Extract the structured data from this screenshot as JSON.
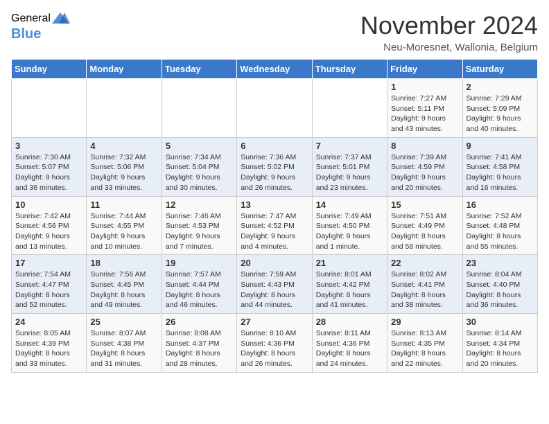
{
  "logo": {
    "general": "General",
    "blue": "Blue"
  },
  "title": "November 2024",
  "location": "Neu-Moresnet, Wallonia, Belgium",
  "headers": [
    "Sunday",
    "Monday",
    "Tuesday",
    "Wednesday",
    "Thursday",
    "Friday",
    "Saturday"
  ],
  "weeks": [
    [
      {
        "day": "",
        "info": ""
      },
      {
        "day": "",
        "info": ""
      },
      {
        "day": "",
        "info": ""
      },
      {
        "day": "",
        "info": ""
      },
      {
        "day": "",
        "info": ""
      },
      {
        "day": "1",
        "info": "Sunrise: 7:27 AM\nSunset: 5:11 PM\nDaylight: 9 hours and 43 minutes."
      },
      {
        "day": "2",
        "info": "Sunrise: 7:29 AM\nSunset: 5:09 PM\nDaylight: 9 hours and 40 minutes."
      }
    ],
    [
      {
        "day": "3",
        "info": "Sunrise: 7:30 AM\nSunset: 5:07 PM\nDaylight: 9 hours and 36 minutes."
      },
      {
        "day": "4",
        "info": "Sunrise: 7:32 AM\nSunset: 5:06 PM\nDaylight: 9 hours and 33 minutes."
      },
      {
        "day": "5",
        "info": "Sunrise: 7:34 AM\nSunset: 5:04 PM\nDaylight: 9 hours and 30 minutes."
      },
      {
        "day": "6",
        "info": "Sunrise: 7:36 AM\nSunset: 5:02 PM\nDaylight: 9 hours and 26 minutes."
      },
      {
        "day": "7",
        "info": "Sunrise: 7:37 AM\nSunset: 5:01 PM\nDaylight: 9 hours and 23 minutes."
      },
      {
        "day": "8",
        "info": "Sunrise: 7:39 AM\nSunset: 4:59 PM\nDaylight: 9 hours and 20 minutes."
      },
      {
        "day": "9",
        "info": "Sunrise: 7:41 AM\nSunset: 4:58 PM\nDaylight: 9 hours and 16 minutes."
      }
    ],
    [
      {
        "day": "10",
        "info": "Sunrise: 7:42 AM\nSunset: 4:56 PM\nDaylight: 9 hours and 13 minutes."
      },
      {
        "day": "11",
        "info": "Sunrise: 7:44 AM\nSunset: 4:55 PM\nDaylight: 9 hours and 10 minutes."
      },
      {
        "day": "12",
        "info": "Sunrise: 7:46 AM\nSunset: 4:53 PM\nDaylight: 9 hours and 7 minutes."
      },
      {
        "day": "13",
        "info": "Sunrise: 7:47 AM\nSunset: 4:52 PM\nDaylight: 9 hours and 4 minutes."
      },
      {
        "day": "14",
        "info": "Sunrise: 7:49 AM\nSunset: 4:50 PM\nDaylight: 9 hours and 1 minute."
      },
      {
        "day": "15",
        "info": "Sunrise: 7:51 AM\nSunset: 4:49 PM\nDaylight: 8 hours and 58 minutes."
      },
      {
        "day": "16",
        "info": "Sunrise: 7:52 AM\nSunset: 4:48 PM\nDaylight: 8 hours and 55 minutes."
      }
    ],
    [
      {
        "day": "17",
        "info": "Sunrise: 7:54 AM\nSunset: 4:47 PM\nDaylight: 8 hours and 52 minutes."
      },
      {
        "day": "18",
        "info": "Sunrise: 7:56 AM\nSunset: 4:45 PM\nDaylight: 8 hours and 49 minutes."
      },
      {
        "day": "19",
        "info": "Sunrise: 7:57 AM\nSunset: 4:44 PM\nDaylight: 8 hours and 46 minutes."
      },
      {
        "day": "20",
        "info": "Sunrise: 7:59 AM\nSunset: 4:43 PM\nDaylight: 8 hours and 44 minutes."
      },
      {
        "day": "21",
        "info": "Sunrise: 8:01 AM\nSunset: 4:42 PM\nDaylight: 8 hours and 41 minutes."
      },
      {
        "day": "22",
        "info": "Sunrise: 8:02 AM\nSunset: 4:41 PM\nDaylight: 8 hours and 38 minutes."
      },
      {
        "day": "23",
        "info": "Sunrise: 8:04 AM\nSunset: 4:40 PM\nDaylight: 8 hours and 36 minutes."
      }
    ],
    [
      {
        "day": "24",
        "info": "Sunrise: 8:05 AM\nSunset: 4:39 PM\nDaylight: 8 hours and 33 minutes."
      },
      {
        "day": "25",
        "info": "Sunrise: 8:07 AM\nSunset: 4:38 PM\nDaylight: 8 hours and 31 minutes."
      },
      {
        "day": "26",
        "info": "Sunrise: 8:08 AM\nSunset: 4:37 PM\nDaylight: 8 hours and 28 minutes."
      },
      {
        "day": "27",
        "info": "Sunrise: 8:10 AM\nSunset: 4:36 PM\nDaylight: 8 hours and 26 minutes."
      },
      {
        "day": "28",
        "info": "Sunrise: 8:11 AM\nSunset: 4:36 PM\nDaylight: 8 hours and 24 minutes."
      },
      {
        "day": "29",
        "info": "Sunrise: 8:13 AM\nSunset: 4:35 PM\nDaylight: 8 hours and 22 minutes."
      },
      {
        "day": "30",
        "info": "Sunrise: 8:14 AM\nSunset: 4:34 PM\nDaylight: 8 hours and 20 minutes."
      }
    ]
  ]
}
